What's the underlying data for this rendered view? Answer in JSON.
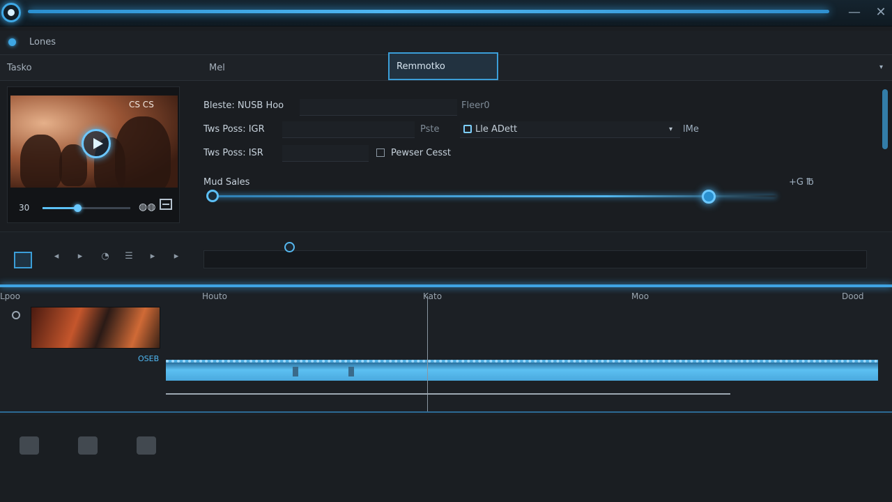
{
  "titlebar": {
    "minimize_icon": "minimize-icon",
    "close_icon": "close-icon",
    "minimize_glyph": "—",
    "close_glyph": "✕"
  },
  "menu": {
    "label": "Lones"
  },
  "tabs": [
    "Tasko",
    "Mel",
    "Remmotko"
  ],
  "tabs_active_index": 2,
  "preview": {
    "badge": "CS CS",
    "time": "30",
    "volume_glyph": "◍◍",
    "scrub_progress": 0.4
  },
  "properties": {
    "row1": {
      "label": "Bleste: NUSB Hoo",
      "hint": "Fleer0"
    },
    "row2": {
      "label": "Tws Poss: IGR",
      "mid": "Pste",
      "select_value": "Lle ADett",
      "suffix": "lMe"
    },
    "row3": {
      "label": "Tws Poss: ISR",
      "checkbox_label": "Pewser Cesst"
    },
    "slider": {
      "label": "Mud Sales",
      "readout": "+G ℔",
      "value": 0.88
    }
  },
  "transport": {
    "buttons": [
      "◂",
      "▸",
      "◔",
      "☰",
      "▸",
      "▸"
    ],
    "progress": 0.13
  },
  "timeline": {
    "ruler": [
      "Lpoo",
      "Houto",
      "Kato",
      "Moo",
      "Dood"
    ],
    "clip_time": "OSEB"
  },
  "colors": {
    "accent": "#3fa3e2",
    "background": "#1a1d21"
  },
  "bottom_tools": [
    "export-icon",
    "render-icon",
    "trash-icon"
  ]
}
